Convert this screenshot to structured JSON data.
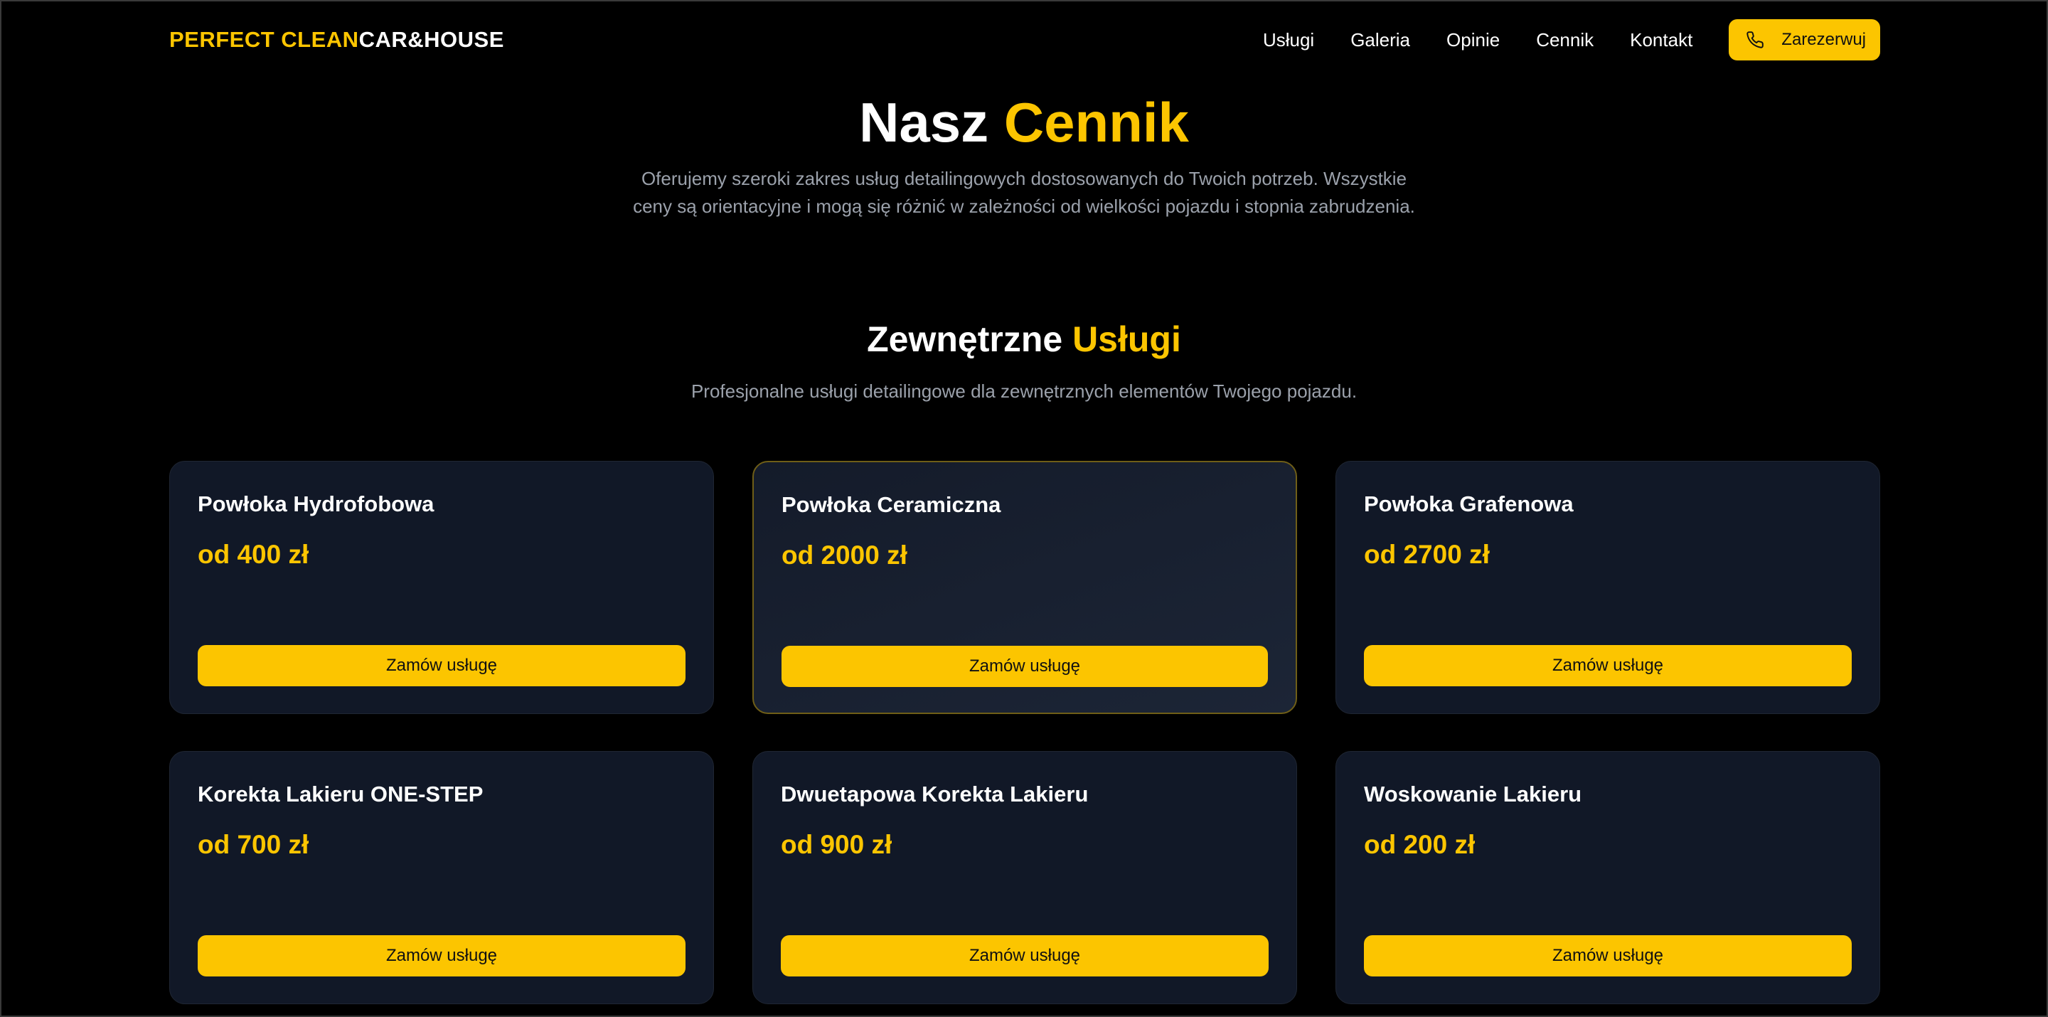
{
  "brand": {
    "accent_part": "PERFECT CLEAN",
    "rest_part": "CAR&HOUSE"
  },
  "nav": {
    "items": [
      {
        "label": "Usługi"
      },
      {
        "label": "Galeria"
      },
      {
        "label": "Opinie"
      },
      {
        "label": "Cennik"
      },
      {
        "label": "Kontakt"
      }
    ],
    "cta_label": "Zarezerwuj",
    "cta_icon": "phone-icon"
  },
  "hero": {
    "title_plain": "Nasz ",
    "title_accent": "Cennik",
    "subtitle": "Oferujemy szeroki zakres usług detailingowych dostosowanych do Twoich potrzeb. Wszystkie ceny są orientacyjne i mogą się różnić w zależności od wielkości pojazdu i stopnia zabrudzenia."
  },
  "section": {
    "title_plain": "Zewnętrzne ",
    "title_accent": "Usługi",
    "subtitle": "Profesjonalne usługi detailingowe dla zewnętrznych elementów Twojego pojazdu."
  },
  "services": [
    {
      "name": "Powłoka Hydrofobowa",
      "price": "od 400 zł",
      "button": "Zamów usługę"
    },
    {
      "name": "Powłoka Ceramiczna",
      "price": "od 2000 zł",
      "button": "Zamów usługę"
    },
    {
      "name": "Powłoka Grafenowa",
      "price": "od 2700 zł",
      "button": "Zamów usługę"
    },
    {
      "name": "Korekta Lakieru ONE-STEP",
      "price": "od 700 zł",
      "button": "Zamów usługę"
    },
    {
      "name": "Dwuetapowa Korekta Lakieru",
      "price": "od 900 zł",
      "button": "Zamów usługę"
    },
    {
      "name": "Woskowanie Lakieru",
      "price": "od 200 zł",
      "button": "Zamów usługę"
    }
  ],
  "colors": {
    "accent": "#fcc500",
    "background": "#000000",
    "card": "#111827",
    "muted_text": "#9ba1ab"
  }
}
